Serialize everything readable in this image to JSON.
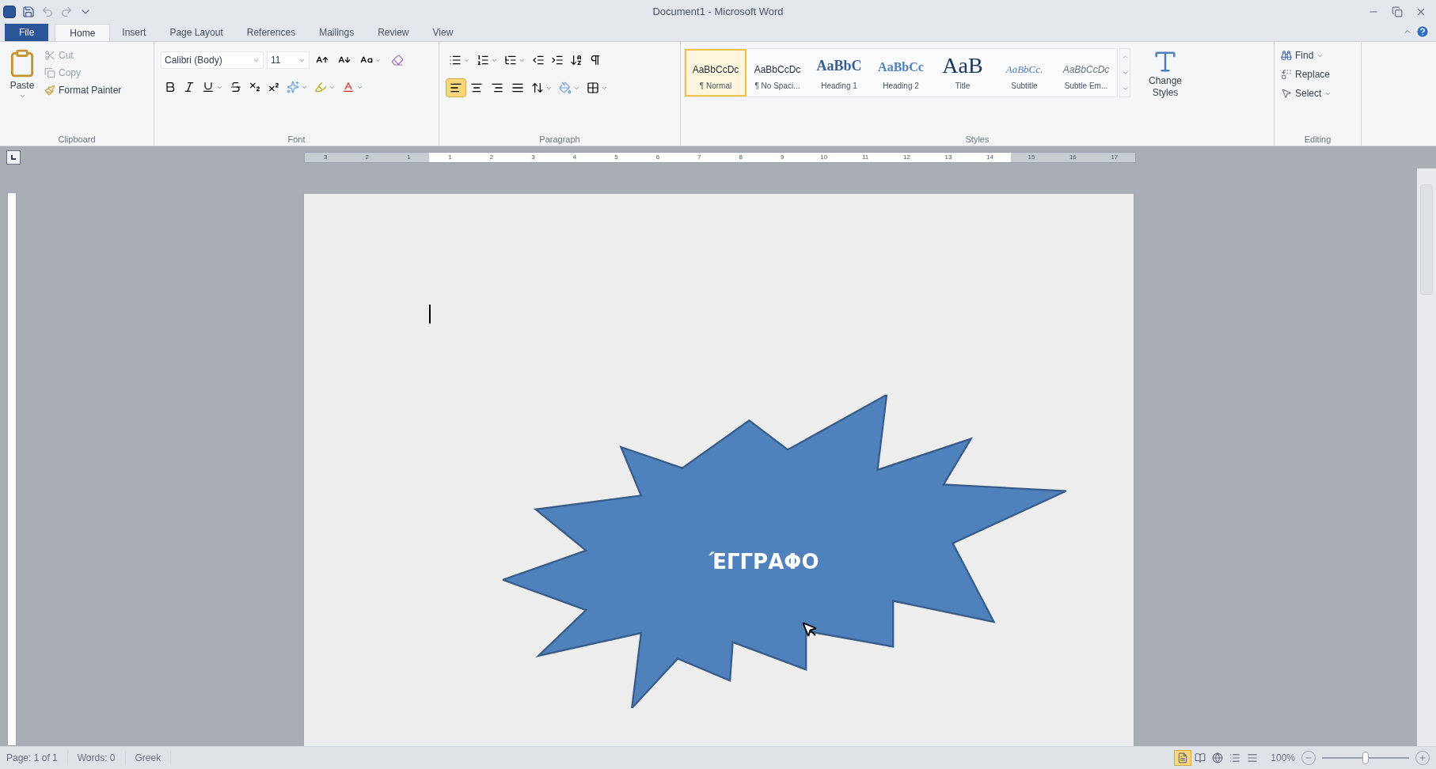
{
  "window": {
    "title": "Document1 - Microsoft Word"
  },
  "tabs": [
    {
      "label": "File",
      "kind": "file",
      "selected": false
    },
    {
      "label": "Home",
      "kind": "tab",
      "selected": true
    },
    {
      "label": "Insert",
      "kind": "tab",
      "selected": false
    },
    {
      "label": "Page Layout",
      "kind": "tab",
      "selected": false
    },
    {
      "label": "References",
      "kind": "tab",
      "selected": false
    },
    {
      "label": "Mailings",
      "kind": "tab",
      "selected": false
    },
    {
      "label": "Review",
      "kind": "tab",
      "selected": false
    },
    {
      "label": "View",
      "kind": "tab",
      "selected": false
    }
  ],
  "clipboard": {
    "label": "Clipboard",
    "paste": "Paste",
    "cut": "Cut",
    "copy": "Copy",
    "format_painter": "Format Painter"
  },
  "font": {
    "label": "Font",
    "font_name": "Calibri (Body)",
    "font_size": "11"
  },
  "paragraph": {
    "label": "Paragraph",
    "alignments": [
      {
        "kind": "left",
        "selected": true
      },
      {
        "kind": "center",
        "selected": false
      },
      {
        "kind": "right",
        "selected": false
      },
      {
        "kind": "justify",
        "selected": false
      }
    ]
  },
  "styles": {
    "label": "Styles",
    "items": [
      {
        "sample": "AaBbCcDc",
        "name": "¶ Normal",
        "kind": "normal",
        "selected": true
      },
      {
        "sample": "AaBbCcDc",
        "name": "¶ No Spaci...",
        "kind": "normal",
        "selected": false
      },
      {
        "sample": "AaBbC",
        "name": "Heading 1",
        "kind": "heading1",
        "selected": false
      },
      {
        "sample": "AaBbCc",
        "name": "Heading 2",
        "kind": "heading2",
        "selected": false
      },
      {
        "sample": "AaB",
        "name": "Title",
        "kind": "title",
        "selected": false
      },
      {
        "sample": "AaBbCc.",
        "name": "Subtitle",
        "kind": "subtitle",
        "selected": false
      },
      {
        "sample": "AaBbCcDc",
        "name": "Subtle Em...",
        "kind": "emphasis",
        "selected": false
      }
    ],
    "change_styles": "Change Styles"
  },
  "editing": {
    "label": "Editing",
    "find": "Find",
    "replace": "Replace",
    "select": "Select"
  },
  "ruler": [
    "3",
    "2",
    "1",
    "1",
    "2",
    "3",
    "4",
    "5",
    "6",
    "7",
    "8",
    "9",
    "10",
    "11",
    "12",
    "13",
    "14",
    "15",
    "16",
    "17"
  ],
  "document": {
    "shape_text": "ΈΓΓΡΑΦΟ"
  },
  "status_bar": {
    "page": "Page: 1 of 1",
    "words": "Words: 0",
    "language": "Greek",
    "zoom": "100%",
    "zoom_level": {
      "level": 0.5
    },
    "views": [
      {
        "kind": "print",
        "selected": true
      },
      {
        "kind": "reading",
        "selected": false
      },
      {
        "kind": "web",
        "selected": false
      },
      {
        "kind": "outline",
        "selected": false
      },
      {
        "kind": "draft",
        "selected": false
      }
    ]
  }
}
